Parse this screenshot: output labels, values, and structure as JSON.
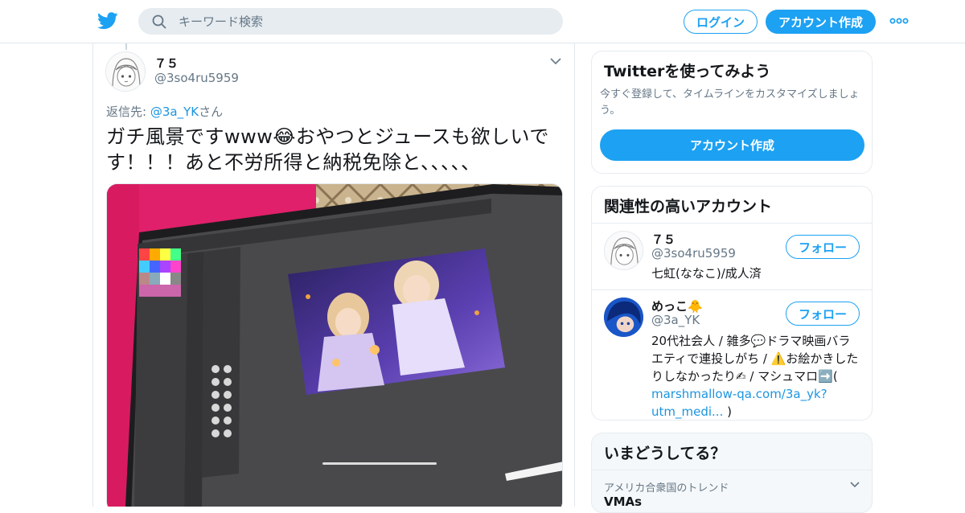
{
  "header": {
    "search_placeholder": "キーワード検索",
    "login_label": "ログイン",
    "signup_label": "アカウント作成",
    "icons": [
      "twitter-bird-icon",
      "search-icon",
      "more-icon"
    ]
  },
  "tweet": {
    "display_name": "７５",
    "handle": "@3so4ru5959",
    "reply_prefix": "返信先: ",
    "reply_mention": "@3a_YK",
    "reply_suffix": "さん",
    "text": "ガチ風景ですwww😂おやつとジュースも欲しいです！！！あと不労所得と納税免除と、、、、、"
  },
  "sidebar": {
    "signup_card": {
      "title": "Twitterを使ってみよう",
      "description": "今すぐ登録して、タイムラインをカスタマイズしましょう。",
      "button": "アカウント作成"
    },
    "related": {
      "title": "関連性の高いアカウント",
      "accounts": [
        {
          "name": "７５",
          "handle": "@3so4ru5959",
          "bio": "七虹(ななこ)/成人済",
          "follow": "フォロー"
        },
        {
          "name": "めっこ🐥",
          "handle": "@3a_YK",
          "bio": "20代社会人 / 雑多💬ドラマ映画バラエティで連投しがち / ⚠️お絵かきしたりしなかったり✍ / マシュマロ➡️(",
          "bio_link": "marshmallow-qa.com/3a_yk?utm_medi...",
          "bio_end": " )",
          "follow": "フォロー"
        }
      ]
    },
    "trends": {
      "title": "いまどうしてる？",
      "items": [
        {
          "context": "アメリカ合衆国のトレンド",
          "name": "VMAs"
        }
      ]
    }
  },
  "colors": {
    "accent": "#1da1f2",
    "link": "#1b95e0",
    "text": "#14171a",
    "muted": "#657786",
    "border": "#e1e8ed"
  }
}
